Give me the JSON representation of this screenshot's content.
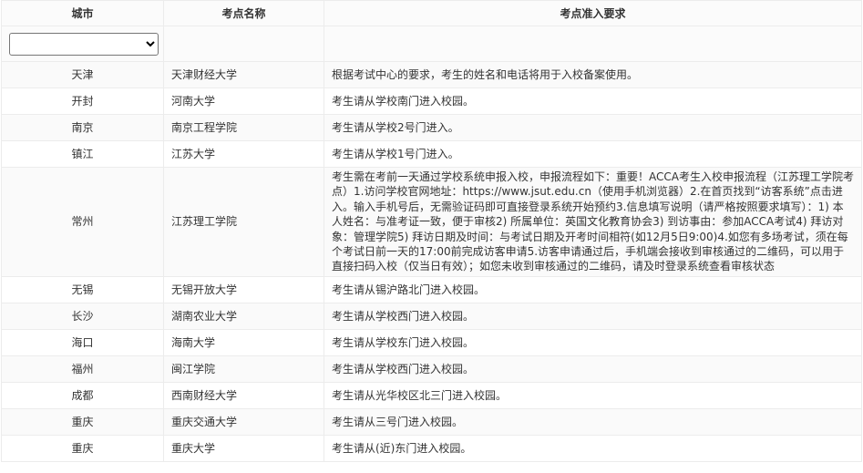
{
  "headers": {
    "city": "城市",
    "site": "考点名称",
    "req": "考点准入要求"
  },
  "filter": {
    "city_select_value": ""
  },
  "rows": [
    {
      "city": "天津",
      "site": "天津财经大学",
      "req": "根据考试中心的要求，考生的姓名和电话将用于入校备案使用。"
    },
    {
      "city": "开封",
      "site": "河南大学",
      "req": "考生请从学校南门进入校园。"
    },
    {
      "city": "南京",
      "site": "南京工程学院",
      "req": "考生请从学校2号门进入。"
    },
    {
      "city": "镇江",
      "site": "江苏大学",
      "req": "考生请从学校1号门进入。"
    },
    {
      "city": "常州",
      "site": "江苏理工学院",
      "req": "考生需在考前一天通过学校系统申报入校，申报流程如下：重要！ACCA考生入校申报流程（江苏理工学院考点）1.访问学校官网地址：https://www.jsut.edu.cn（使用手机浏览器）2.在首页找到“访客系统”点击进入。输入手机号后，无需验证码即可直接登录系统开始预约3.信息填写说明（请严格按照要求填写）：1) 本人姓名：与准考证一致，便于审核2) 所属单位：英国文化教育协会3) 到访事由：参加ACCA考试4) 拜访对象：管理学院5) 拜访日期及时间：与考试日期及开考时间相符(如12月5日9:00)4.如您有多场考试，须在每个考试日前一天的17:00前完成访客申请5.访客申请通过后，手机端会接收到审核通过的二维码，可以用于直接扫码入校（仅当日有效）；如您未收到审核通过的二维码，请及时登录系统查看审核状态"
    },
    {
      "city": "无锡",
      "site": "无锡开放大学",
      "req": "考生请从锡沪路北门进入校园。"
    },
    {
      "city": "长沙",
      "site": "湖南农业大学",
      "req": "考生请从学校西门进入校园。"
    },
    {
      "city": "海口",
      "site": "海南大学",
      "req": "考生请从学校东门进入校园。"
    },
    {
      "city": "福州",
      "site": "闽江学院",
      "req": "考生请从学校西门进入校园。"
    },
    {
      "city": "成都",
      "site": "西南财经大学",
      "req": "考生请从光华校区北三门进入校园。"
    },
    {
      "city": "重庆",
      "site": "重庆交通大学",
      "req": "考生请从三号门进入校园。"
    },
    {
      "city": "重庆",
      "site": "重庆大学",
      "req": "考生请从(近)东门进入校园。"
    }
  ]
}
